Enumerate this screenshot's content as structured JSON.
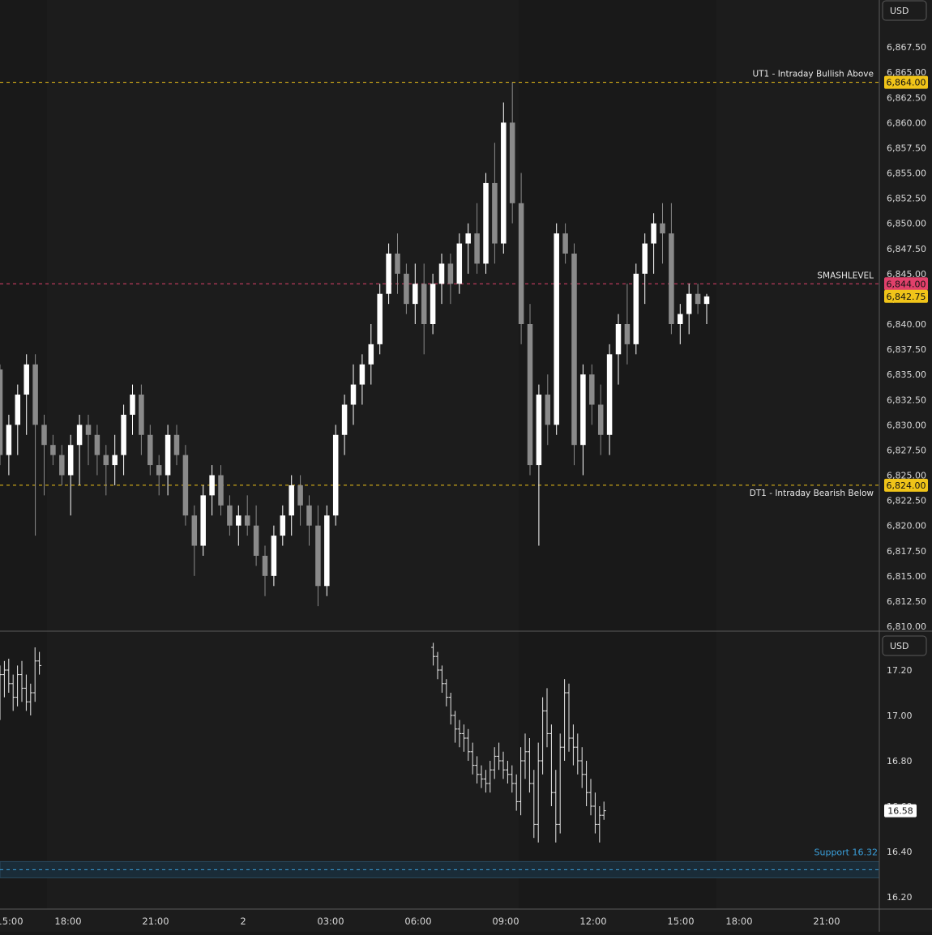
{
  "currency_button": "USD",
  "x_axis_ticks": [
    "15:00",
    "18:00",
    "21:00",
    "2",
    "03:00",
    "06:00",
    "09:00",
    "12:00",
    "15:00",
    "18:00",
    "21:00"
  ],
  "colors": {
    "background": "#1c1c1c",
    "session_shade": "#191919",
    "candle_up": "#ffffff",
    "candle_down": "#8a8a8a",
    "level_yellow": "#f0c419",
    "level_pink": "#e0406a",
    "support_line": "#3aa0dc",
    "support_zone": "#1a2c38"
  },
  "chart_data": [
    {
      "type": "candlestick",
      "currency": "USD",
      "ylim": [
        6810,
        6870
      ],
      "y_ticks": [
        "6,810.00",
        "6,812.50",
        "6,815.00",
        "6,817.50",
        "6,820.00",
        "6,822.50",
        "6,825.00",
        "6,827.50",
        "6,830.00",
        "6,832.50",
        "6,835.00",
        "6,837.50",
        "6,840.00",
        "6,842.50",
        "6,845.00",
        "6,847.50",
        "6,850.00",
        "6,852.50",
        "6,855.00",
        "6,857.50",
        "6,860.00",
        "6,862.50",
        "6,865.00",
        "6,867.50"
      ],
      "levels": [
        {
          "label": "UT1 - Intraday Bullish Above",
          "value": 6864.0,
          "badge": "6,864.00",
          "color": "#f0c419"
        },
        {
          "label": "SMASHLEVEL",
          "value": 6844.0,
          "badge": "6,844.00",
          "color": "#e0406a"
        },
        {
          "label": "DT1 - Intraday Bearish Below",
          "value": 6824.0,
          "badge": "6,824.00",
          "color": "#f0c419"
        }
      ],
      "last_price": {
        "value": 6842.75,
        "badge": "6,842.75"
      },
      "series": [
        {
          "values": [
            [
              6835.5,
              6836,
              6826,
              6827
            ],
            [
              6827,
              6831,
              6825,
              6830
            ],
            [
              6830,
              6834,
              6827,
              6833
            ],
            [
              6833,
              6837,
              6829,
              6836
            ],
            [
              6836,
              6837,
              6819,
              6830
            ],
            [
              6830,
              6831,
              6823,
              6828
            ],
            [
              6828,
              6829,
              6826,
              6827
            ],
            [
              6827,
              6828,
              6824,
              6825
            ],
            [
              6825,
              6829,
              6821,
              6828
            ],
            [
              6828,
              6831,
              6824,
              6830
            ],
            [
              6830,
              6831,
              6826,
              6829
            ],
            [
              6829,
              6830,
              6825,
              6827
            ],
            [
              6827,
              6828,
              6823,
              6826
            ],
            [
              6826,
              6829,
              6824,
              6827
            ],
            [
              6827,
              6832,
              6825,
              6831
            ],
            [
              6831,
              6834,
              6829,
              6833
            ],
            [
              6833,
              6834,
              6827,
              6829
            ],
            [
              6829,
              6830,
              6825,
              6826
            ],
            [
              6826,
              6827,
              6823,
              6825
            ],
            [
              6825,
              6830,
              6823,
              6829
            ],
            [
              6829,
              6830,
              6826,
              6827
            ],
            [
              6827,
              6828,
              6820,
              6821
            ],
            [
              6821,
              6822,
              6815,
              6818
            ],
            [
              6818,
              6824,
              6817,
              6823
            ],
            [
              6823,
              6826,
              6821,
              6825
            ],
            [
              6825,
              6826,
              6821,
              6822
            ],
            [
              6822,
              6823,
              6819,
              6820
            ],
            [
              6820,
              6822,
              6818,
              6821
            ],
            [
              6821,
              6823,
              6819,
              6820
            ],
            [
              6820,
              6822,
              6816,
              6817
            ],
            [
              6817,
              6818,
              6813,
              6815
            ],
            [
              6815,
              6820,
              6814,
              6819
            ],
            [
              6819,
              6822,
              6818,
              6821
            ],
            [
              6821,
              6825,
              6819,
              6824
            ],
            [
              6824,
              6825,
              6820,
              6822
            ],
            [
              6822,
              6823,
              6818,
              6820
            ],
            [
              6820,
              6822,
              6812,
              6814
            ],
            [
              6814,
              6822,
              6813,
              6821
            ],
            [
              6821,
              6830,
              6820,
              6829
            ],
            [
              6829,
              6833,
              6827,
              6832
            ],
            [
              6832,
              6836,
              6830,
              6834
            ],
            [
              6834,
              6837,
              6832,
              6836
            ],
            [
              6836,
              6840,
              6834,
              6838
            ],
            [
              6838,
              6844,
              6837,
              6843
            ],
            [
              6843,
              6848,
              6842,
              6847
            ],
            [
              6847,
              6849,
              6843,
              6845
            ],
            [
              6845,
              6846,
              6841,
              6842
            ],
            [
              6842,
              6846,
              6840,
              6844
            ],
            [
              6844,
              6846,
              6837,
              6840
            ],
            [
              6840,
              6845,
              6839,
              6844
            ],
            [
              6844,
              6847,
              6842,
              6846
            ],
            [
              6846,
              6847,
              6842,
              6844
            ],
            [
              6844,
              6849,
              6843,
              6848
            ],
            [
              6848,
              6850,
              6845,
              6849
            ],
            [
              6849,
              6852,
              6845,
              6846
            ],
            [
              6846,
              6855,
              6845,
              6854
            ],
            [
              6854,
              6858,
              6846,
              6848
            ],
            [
              6848,
              6862,
              6847,
              6860
            ],
            [
              6860,
              6864,
              6850,
              6852
            ],
            [
              6852,
              6855,
              6838,
              6840
            ],
            [
              6840,
              6842,
              6825,
              6826
            ],
            [
              6826,
              6834,
              6818,
              6833
            ],
            [
              6833,
              6835,
              6828,
              6830
            ],
            [
              6830,
              6850,
              6829,
              6849
            ],
            [
              6849,
              6850,
              6846,
              6847
            ],
            [
              6847,
              6848,
              6826,
              6828
            ],
            [
              6828,
              6836,
              6825,
              6835
            ],
            [
              6835,
              6836,
              6830,
              6832
            ],
            [
              6832,
              6834,
              6827,
              6829
            ],
            [
              6829,
              6838,
              6827,
              6837
            ],
            [
              6837,
              6841,
              6834,
              6840
            ],
            [
              6840,
              6844,
              6836,
              6838
            ],
            [
              6838,
              6846,
              6837,
              6845
            ],
            [
              6845,
              6849,
              6842,
              6848
            ],
            [
              6848,
              6851,
              6845,
              6850
            ],
            [
              6850,
              6852,
              6846,
              6849
            ],
            [
              6849,
              6852,
              6839,
              6840
            ],
            [
              6840,
              6842,
              6838,
              6841
            ],
            [
              6841,
              6844,
              6839,
              6843
            ],
            [
              6843,
              6844,
              6841,
              6842
            ],
            [
              6842,
              6843,
              6840,
              6842.75
            ]
          ]
        }
      ]
    },
    {
      "type": "ohlc",
      "currency": "USD",
      "ylim": [
        16.15,
        17.35
      ],
      "y_ticks": [
        "16.20",
        "16.40",
        "16.60",
        "16.80",
        "17.00",
        "17.20"
      ],
      "support": {
        "label": "Support 16.32",
        "value": 16.32
      },
      "last_price": {
        "value": 16.58,
        "badge": "16.58"
      },
      "series": [
        {
          "segments": [
            {
              "start": 0,
              "bars": [
                [
                  17.12,
                  17.22,
                  16.98,
                  17.18
                ],
                [
                  17.18,
                  17.24,
                  17.08,
                  17.2
                ],
                [
                  17.2,
                  17.25,
                  17.1,
                  17.14
                ],
                [
                  17.14,
                  17.18,
                  17.02,
                  17.08
                ],
                [
                  17.08,
                  17.22,
                  17.04,
                  17.18
                ],
                [
                  17.18,
                  17.24,
                  17.06,
                  17.12
                ],
                [
                  17.12,
                  17.18,
                  17.02,
                  17.06
                ],
                [
                  17.06,
                  17.14,
                  17.0,
                  17.1
                ],
                [
                  17.1,
                  17.3,
                  17.06,
                  17.24
                ],
                [
                  17.24,
                  17.28,
                  17.18,
                  17.22
                ]
              ]
            },
            {
              "start": 99,
              "bars": [
                [
                  17.3,
                  17.32,
                  17.22,
                  17.26
                ],
                [
                  17.26,
                  17.28,
                  17.16,
                  17.2
                ],
                [
                  17.2,
                  17.22,
                  17.1,
                  17.14
                ],
                [
                  17.14,
                  17.16,
                  17.04,
                  17.08
                ],
                [
                  17.08,
                  17.1,
                  16.96,
                  17.0
                ],
                [
                  17.0,
                  17.02,
                  16.88,
                  16.94
                ],
                [
                  16.94,
                  16.98,
                  16.86,
                  16.92
                ],
                [
                  16.92,
                  16.96,
                  16.84,
                  16.9
                ],
                [
                  16.9,
                  16.94,
                  16.8,
                  16.84
                ],
                [
                  16.84,
                  16.88,
                  16.74,
                  16.78
                ],
                [
                  16.78,
                  16.82,
                  16.7,
                  16.74
                ],
                [
                  16.74,
                  16.78,
                  16.68,
                  16.72
                ],
                [
                  16.72,
                  16.76,
                  16.66,
                  16.7
                ],
                [
                  16.7,
                  16.8,
                  16.66,
                  16.76
                ],
                [
                  16.76,
                  16.86,
                  16.72,
                  16.82
                ],
                [
                  16.82,
                  16.88,
                  16.76,
                  16.8
                ],
                [
                  16.8,
                  16.84,
                  16.72,
                  16.76
                ],
                [
                  16.76,
                  16.8,
                  16.7,
                  16.74
                ],
                [
                  16.74,
                  16.78,
                  16.66,
                  16.7
                ],
                [
                  16.7,
                  16.74,
                  16.58,
                  16.62
                ],
                [
                  16.62,
                  16.86,
                  16.56,
                  16.8
                ],
                [
                  16.8,
                  16.92,
                  16.72,
                  16.84
                ],
                [
                  16.84,
                  16.9,
                  16.66,
                  16.7
                ],
                [
                  16.7,
                  16.76,
                  16.46,
                  16.52
                ],
                [
                  16.52,
                  16.88,
                  16.44,
                  16.8
                ],
                [
                  16.8,
                  17.08,
                  16.74,
                  17.02
                ],
                [
                  17.02,
                  17.12,
                  16.86,
                  16.92
                ],
                [
                  16.92,
                  16.96,
                  16.6,
                  16.66
                ],
                [
                  16.66,
                  16.76,
                  16.44,
                  16.52
                ],
                [
                  16.52,
                  16.92,
                  16.48,
                  16.86
                ],
                [
                  16.86,
                  17.16,
                  16.8,
                  17.1
                ],
                [
                  17.1,
                  17.14,
                  16.84,
                  16.9
                ],
                [
                  16.9,
                  16.96,
                  16.78,
                  16.86
                ],
                [
                  16.86,
                  16.92,
                  16.74,
                  16.8
                ],
                [
                  16.8,
                  16.86,
                  16.68,
                  16.74
                ],
                [
                  16.74,
                  16.8,
                  16.6,
                  16.66
                ],
                [
                  16.66,
                  16.72,
                  16.56,
                  16.6
                ],
                [
                  16.6,
                  16.66,
                  16.48,
                  16.52
                ],
                [
                  16.52,
                  16.6,
                  16.44,
                  16.56
                ],
                [
                  16.56,
                  16.62,
                  16.54,
                  16.58
                ]
              ]
            }
          ]
        }
      ]
    }
  ]
}
